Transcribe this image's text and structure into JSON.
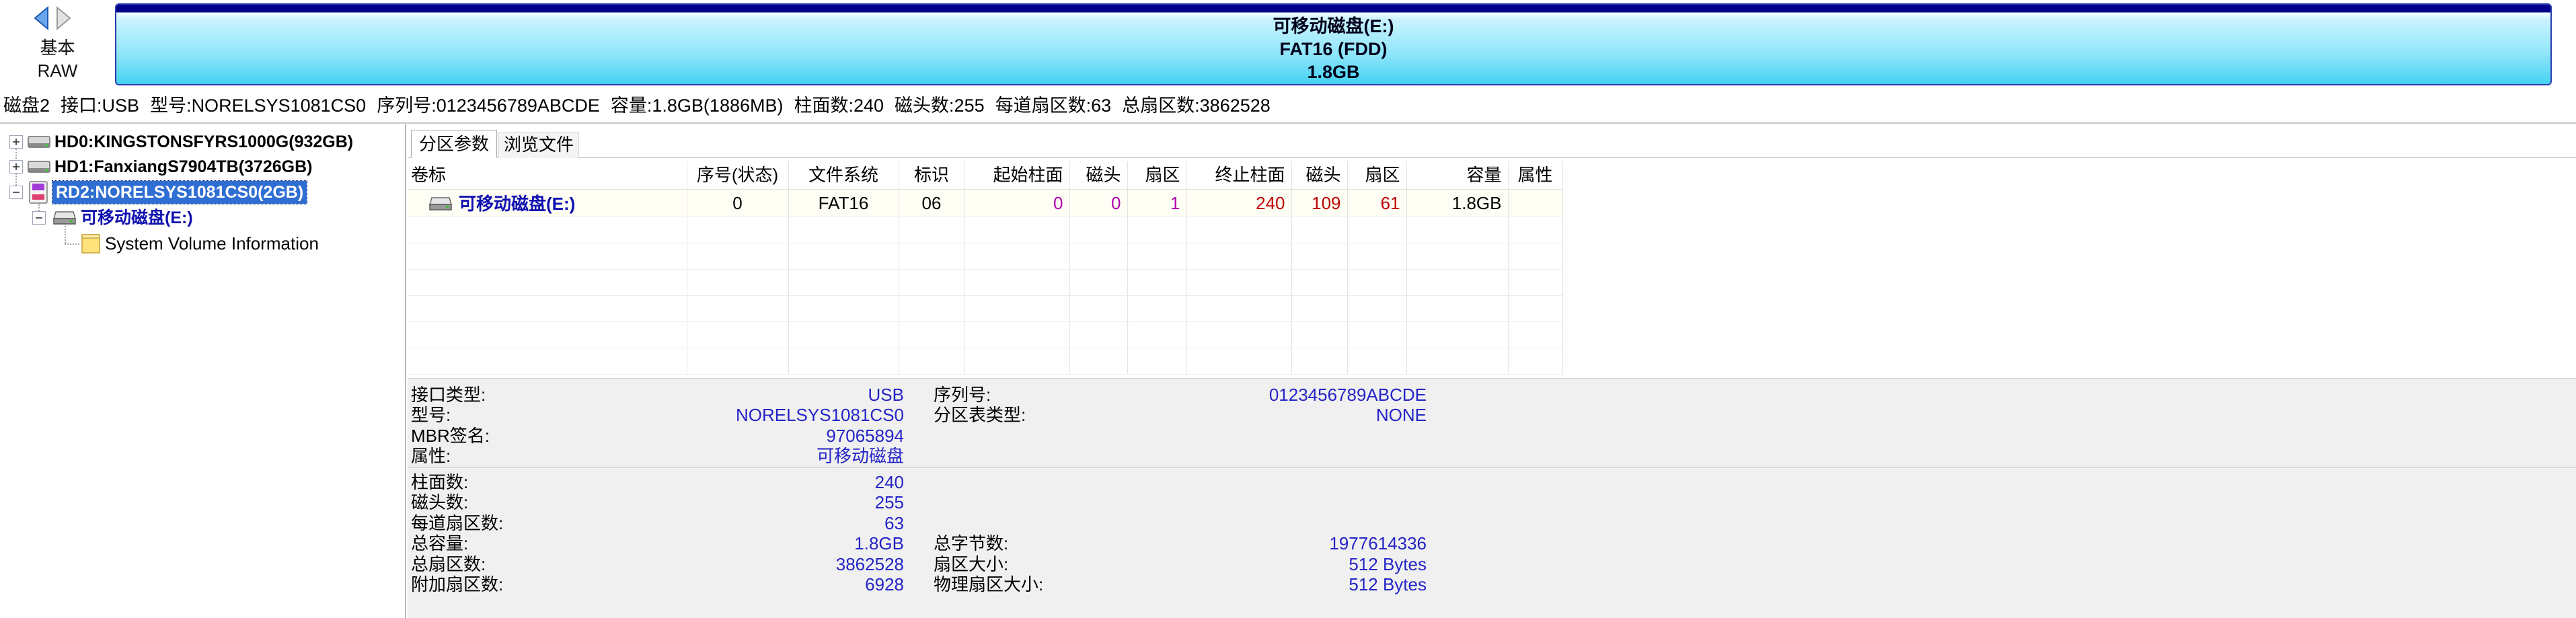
{
  "colors": {
    "value_blue": "#2424c8",
    "volume_blue": "#1010b0",
    "start_magenta": "#b000b0",
    "end_red": "#c00000",
    "selection": "#2f6ed3",
    "bar_navy": "#00008c",
    "bar_cyan": "#44d2f3"
  },
  "nav": {
    "back_icon": "arrow-left-icon",
    "forward_icon": "arrow-right-icon",
    "disk_type": "基本",
    "partition_style": "RAW"
  },
  "disk_bar": {
    "name": "可移动磁盘(E:)",
    "filesystem": "FAT16 (FDD)",
    "size": "1.8GB"
  },
  "disk_info": {
    "disk": "磁盘2",
    "interface": "接口:USB",
    "model": "型号:NORELSYS1081CS0",
    "serial": "序列号:0123456789ABCDE",
    "capacity": "容量:1.8GB(1886MB)",
    "cylinders": "柱面数:240",
    "heads": "磁头数:255",
    "sectors_per_track": "每道扇区数:63",
    "total_sectors": "总扇区数:3862528"
  },
  "tree": {
    "disks": [
      {
        "label": "HD0:KINGSTONSFYRS1000G(932GB)",
        "icon": "hard-disk-icon",
        "expanded": false
      },
      {
        "label": "HD1:FanxiangS7904TB(3726GB)",
        "icon": "hard-disk-icon",
        "expanded": false
      },
      {
        "label": "RD2:NORELSYS1081CS0(2GB)",
        "icon": "removable-disk-icon",
        "expanded": true,
        "selected": true
      }
    ],
    "partition": {
      "label": "可移动磁盘(E:)",
      "icon": "drive-icon",
      "expanded": true
    },
    "folder": {
      "label": "System Volume Information",
      "icon": "folder-icon"
    }
  },
  "tabs": [
    {
      "label": "分区参数",
      "active": true
    },
    {
      "label": "浏览文件",
      "active": false
    }
  ],
  "partition_table": {
    "headers": [
      "卷标",
      "序号(状态)",
      "文件系统",
      "标识",
      "起始柱面",
      "磁头",
      "扇区",
      "终止柱面",
      "磁头",
      "扇区",
      "容量",
      "属性"
    ],
    "rows": [
      {
        "volume": "可移动磁盘(E:)",
        "index": "0",
        "filesystem": "FAT16",
        "id": "06",
        "start_cylinder": "0",
        "start_head": "0",
        "start_sector": "1",
        "end_cylinder": "240",
        "end_head": "109",
        "end_sector": "61",
        "capacity": "1.8GB"
      }
    ]
  },
  "details": {
    "section1": [
      {
        "label": "接口类型:",
        "value": "USB",
        "label2": "序列号:",
        "value2": "0123456789ABCDE"
      },
      {
        "label": "型号:",
        "value": "NORELSYS1081CS0",
        "label2": "分区表类型:",
        "value2": "NONE"
      },
      {
        "label": "MBR签名:",
        "value": "97065894"
      },
      {
        "label": "属性:",
        "value": "可移动磁盘"
      }
    ],
    "section2": [
      {
        "label": "柱面数:",
        "value": "240"
      },
      {
        "label": "磁头数:",
        "value": "255"
      },
      {
        "label": "每道扇区数:",
        "value": "63"
      },
      {
        "label": "总容量:",
        "value": "1.8GB",
        "label2": "总字节数:",
        "value2": "1977614336"
      },
      {
        "label": "总扇区数:",
        "value": "3862528",
        "label2": "扇区大小:",
        "value2": "512 Bytes"
      },
      {
        "label": "附加扇区数:",
        "value": "6928",
        "label2": "物理扇区大小:",
        "value2": "512 Bytes"
      }
    ]
  }
}
